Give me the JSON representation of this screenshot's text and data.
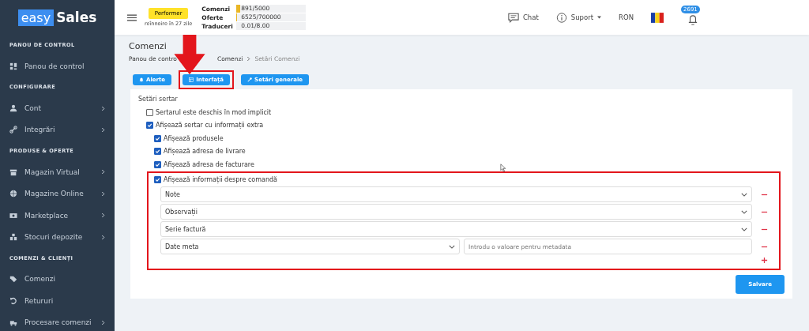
{
  "logo": {
    "part_1": "easy",
    "part_2": "Sales"
  },
  "sidebar": {
    "sections": [
      {
        "title": "PANOU DE CONTROL",
        "items": [
          {
            "label": "Panou de control",
            "has_submenu": false
          }
        ]
      },
      {
        "title": "CONFIGURARE",
        "items": [
          {
            "label": "Cont",
            "has_submenu": true
          },
          {
            "label": "Integrări",
            "has_submenu": true
          }
        ]
      },
      {
        "title": "PRODUSE & OFERTE",
        "items": [
          {
            "label": "Magazin Virtual",
            "has_submenu": true
          },
          {
            "label": "Magazine Online",
            "has_submenu": true
          },
          {
            "label": "Marketplace",
            "has_submenu": true
          },
          {
            "label": "Stocuri depozite",
            "has_submenu": true
          }
        ]
      },
      {
        "title": "COMENZI & CLIENȚI",
        "items": [
          {
            "label": "Comenzi",
            "has_submenu": false
          },
          {
            "label": "Retururi",
            "has_submenu": false
          },
          {
            "label": "Procesare comenzi",
            "has_submenu": true
          }
        ]
      }
    ]
  },
  "header": {
    "plan": {
      "badge": "Performer",
      "renewal": "reînnoire în 27 zile"
    },
    "usage": [
      {
        "label": "Comenzi",
        "value": "891/5000",
        "level": 0.05
      },
      {
        "label": "Oferte",
        "value": "6525/700000",
        "level": 0.01
      },
      {
        "label": "Traduceri",
        "value": "0.01/8.00",
        "level": 0
      }
    ],
    "chat": "Chat",
    "support": "Suport",
    "currency": "RON",
    "notifications": "2691"
  },
  "page": {
    "title": "Comenzi",
    "breadcrumb": [
      "Panou de contro",
      "Comenzi",
      "Setări Comenzi"
    ],
    "tabs": [
      {
        "label": "Alerte",
        "highlighted": false
      },
      {
        "label": "Interfață",
        "highlighted": true
      },
      {
        "label": "Setări generale",
        "highlighted": false
      }
    ],
    "section_title": "Setări sertar",
    "options": [
      {
        "label": "Sertarul este deschis în mod implicit",
        "checked": false
      },
      {
        "label": "Afișează sertar cu informații extra",
        "checked": true,
        "children": [
          {
            "label": "Afișează produsele",
            "checked": true
          },
          {
            "label": "Afișează adresa de livrare",
            "checked": true
          },
          {
            "label": "Afișează adresa de facturare",
            "checked": true
          },
          {
            "label": "Afișează informații despre comandă",
            "checked": true,
            "highlighted": true,
            "fields": [
              {
                "kind": "select",
                "value": "Note"
              },
              {
                "kind": "select",
                "value": "Observații"
              },
              {
                "kind": "select",
                "value": "Serie factură"
              },
              {
                "kind": "select_input",
                "value": "Date meta",
                "placeholder": "Introdu o valoare pentru metadata"
              }
            ]
          }
        ]
      }
    ],
    "save": "Salvare"
  }
}
